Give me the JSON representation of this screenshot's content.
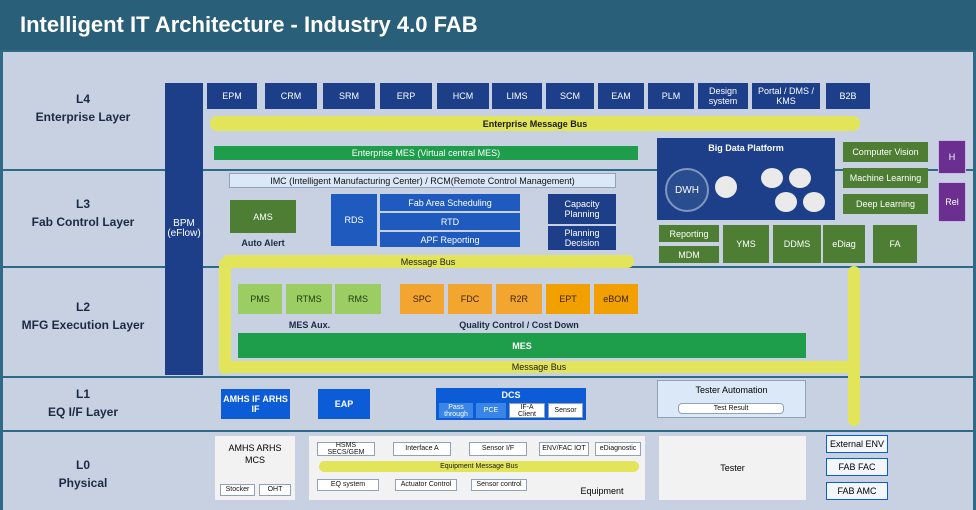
{
  "title": "Intelligent IT Architecture - Industry 4.0 FAB",
  "layers": {
    "l4": {
      "code": "L4",
      "name": "Enterprise Layer"
    },
    "l3": {
      "code": "L3",
      "name": "Fab Control Layer"
    },
    "l2": {
      "code": "L2",
      "name": "MFG Execution Layer"
    },
    "l1": {
      "code": "L1",
      "name": "EQ I/F Layer"
    },
    "l0": {
      "code": "L0",
      "name": "Physical"
    }
  },
  "bpm": "BPM (eFlow)",
  "enterprise_systems": [
    "EPM",
    "CRM",
    "SRM",
    "ERP",
    "HCM",
    "LIMS",
    "SCM",
    "EAM",
    "PLM",
    "Design system",
    "Portal / DMS / KMS",
    "B2B"
  ],
  "enterprise_bus": "Enterprise Message Bus",
  "enterprise_mes": "Enterprise MES (Virtual central MES)",
  "big_data": {
    "title": "Big Data Platform",
    "dwh": "DWH",
    "ai": [
      "Computer Vision",
      "Machine Learning",
      "Deep Learning"
    ],
    "right_tags": [
      "H",
      "Rel"
    ]
  },
  "imc": "IMC (Intelligent Manufacturing Center) / RCM(Remote Control Management)",
  "ams": "AMS",
  "auto_alert": "Auto Alert",
  "rds": "RDS",
  "fab_items": [
    "Fab Area Scheduling",
    "RTD",
    "APF Reporting"
  ],
  "capacity_planning": "Capacity Planning",
  "planning_decision": "Planning Decision",
  "reporting": "Reporting",
  "mdm": "MDM",
  "analytics": [
    "YMS",
    "DDMS",
    "eDiag",
    "FA"
  ],
  "message_bus": "Message Bus",
  "mes_aux": {
    "items": [
      "PMS",
      "RTMS",
      "RMS"
    ],
    "caption": "MES Aux."
  },
  "quality": {
    "items": [
      "SPC",
      "FDC",
      "R2R",
      "EPT",
      "eBOM"
    ],
    "caption": "Quality Control / Cost Down"
  },
  "mes": "MES",
  "message_bus_2": "Message Bus",
  "amhs_if": "AMHS IF ARHS IF",
  "eap": "EAP",
  "dcs": {
    "title": "DCS",
    "items": [
      "Pass through",
      "PCE",
      "IF-A Client",
      "Sensor"
    ]
  },
  "tester_automation": "Tester Automation",
  "test_result": "Test Result",
  "amhs": {
    "title": "AMHS ARHS MCS",
    "items": [
      "Stocker",
      "OHT"
    ]
  },
  "equipment": {
    "top": [
      "HSMS SECS/GEM",
      "Interface A",
      "Sensor I/F",
      "ENV/FAC IOT",
      "eDiagnostic"
    ],
    "bus": "Equipment Message Bus",
    "bottom": [
      "EQ system",
      "Actuator Control",
      "Sensor control"
    ],
    "caption": "Equipment"
  },
  "tester": "Tester",
  "facilities": [
    "External ENV",
    "FAB FAC",
    "FAB AMC"
  ],
  "colors": {
    "title_bg": "#2a5f7a",
    "bus": "#e2e55a",
    "mes_green": "#1e9e4a"
  }
}
